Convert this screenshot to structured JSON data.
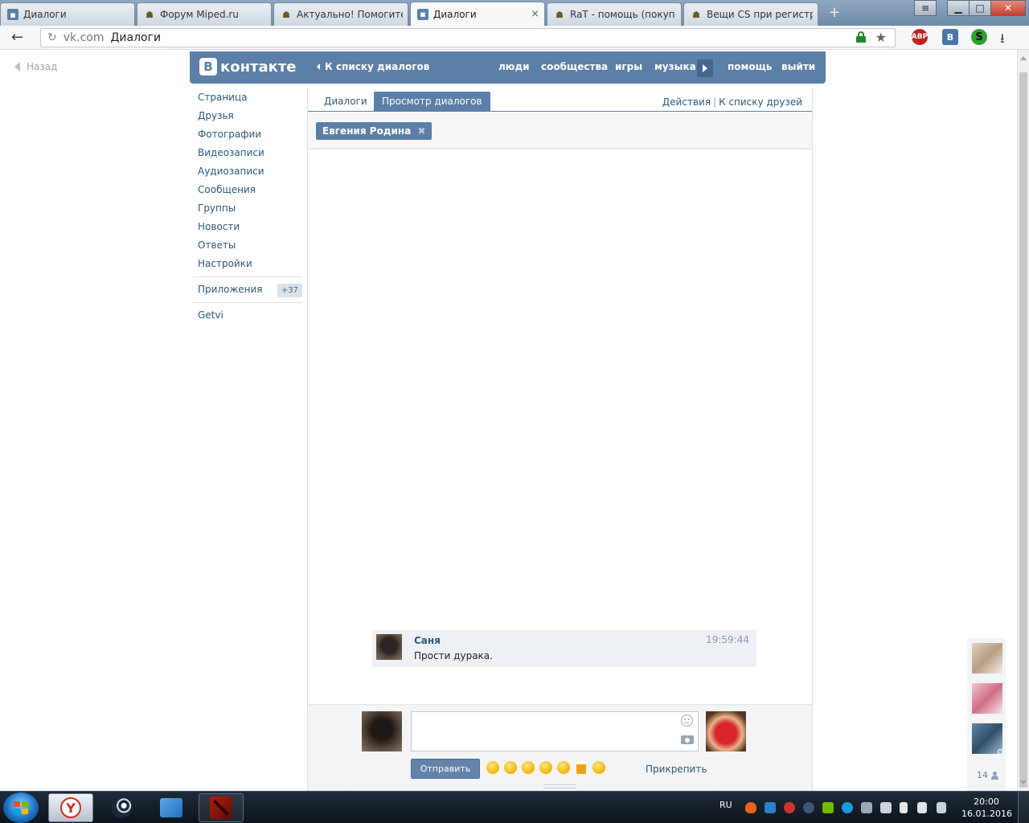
{
  "browser": {
    "tabs": [
      {
        "label": "Диалоги",
        "favicon": "vk-message-icon",
        "active": false
      },
      {
        "label": "Форум Miped.ru",
        "favicon": "bug-favicon-icon",
        "active": false
      },
      {
        "label": "Актуально! Помогите",
        "favicon": "bug-favicon-icon",
        "active": false
      },
      {
        "label": "Диалоги",
        "favicon": "vk-message-icon",
        "active": true
      },
      {
        "label": "RaT - помощь (покуп",
        "favicon": "bug-favicon-icon",
        "active": false
      },
      {
        "label": "Вещи CS при регистр",
        "favicon": "bug-favicon-icon",
        "active": false
      }
    ],
    "tab_close_glyph": "×",
    "new_tab_glyph": "+",
    "window_buttons": {
      "menu": "≡",
      "minimize": "▁",
      "maximize": "□",
      "close": "✕"
    },
    "address": {
      "host": "vk.com",
      "title": "Диалоги"
    },
    "extensions": {
      "abp": "ABP",
      "vk": "B",
      "s": "S"
    }
  },
  "page": {
    "back_link": "Назад",
    "header": {
      "logo_letter": "В",
      "logo_text": "контакте",
      "to_dialogs": "К списку диалогов",
      "nav": [
        "люди",
        "сообщества",
        "игры",
        "музыка",
        "помощь",
        "выйти"
      ]
    },
    "left_menu": {
      "items": [
        "Страница",
        "Друзья",
        "Фотографии",
        "Видеозаписи",
        "Аудиозаписи",
        "Сообщения",
        "Группы",
        "Новости",
        "Ответы",
        "Настройки"
      ],
      "apps_label": "Приложения",
      "apps_badge": "+37",
      "extra": "Getvi"
    },
    "content": {
      "tabs": [
        {
          "label": "Диалоги",
          "active": false
        },
        {
          "label": "Просмотр диалогов",
          "active": true
        }
      ],
      "actions": [
        "Действия",
        "К списку друзей"
      ],
      "actions_separator": "|",
      "peer_token": {
        "name": "Евгения Родина",
        "remove_glyph": "✖"
      },
      "message": {
        "author": "Саня",
        "text": "Прости дурака.",
        "time": "19:59:44"
      },
      "compose": {
        "input_value": "",
        "send_label": "Отправить",
        "attach_label": "Прикрепить",
        "emojis": [
          "laughing-emoji",
          "joy-emoji",
          "smile-emoji",
          "surprised-emoji",
          "disappointed-emoji",
          "beer-emoji",
          "smirk-emoji"
        ]
      }
    },
    "side_friends": {
      "count": "14"
    }
  },
  "taskbar": {
    "apps": [
      "yandex-browser",
      "steam",
      "lego-app",
      "dota2"
    ],
    "yandex_glyph": "Y",
    "language": "RU",
    "time": "20:00",
    "date": "16.01.2016"
  },
  "colors": {
    "vk_blue": "#5b7fa6",
    "link": "#2b587a",
    "message_bg": "#edf1f5",
    "taskbar": "#0d141c"
  }
}
